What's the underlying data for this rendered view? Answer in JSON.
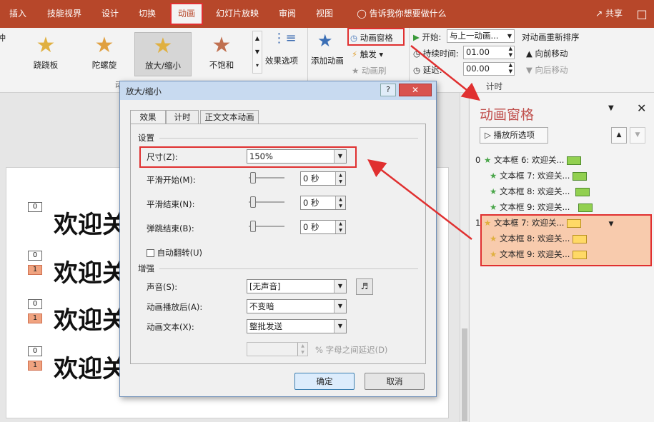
{
  "tabs": [
    "插入",
    "技能视界",
    "设计",
    "切换",
    "动画",
    "幻灯片放映",
    "审阅",
    "视图"
  ],
  "tell_me": "告诉我你想要做什么",
  "share": "共享",
  "gallery": {
    "partial": "冲",
    "items": [
      "跷跷板",
      "陀螺旋",
      "放大/缩小",
      "不饱和"
    ]
  },
  "effect_options": "效果选项",
  "group_animation_partial": "动",
  "add_animation": "添加动画",
  "anim_pane_button": "动画窗格",
  "trigger": "触发",
  "anim_brush": "动画刷",
  "timing": {
    "start_label": "开始:",
    "start_value": "与上一动画...",
    "duration_label": "持续时间:",
    "duration_value": "01.00",
    "delay_label": "延迟:",
    "delay_value": "00.00",
    "group": "计时"
  },
  "reorder": {
    "title": "对动画重新排序",
    "forward": "向前移动",
    "backward": "向后移动"
  },
  "slide": {
    "rows": [
      {
        "badges": [
          "0"
        ],
        "text": "欢迎关"
      },
      {
        "badges": [
          "0",
          "1"
        ],
        "text": "欢迎关"
      },
      {
        "badges": [
          "0",
          "1"
        ],
        "text": "欢迎关"
      },
      {
        "badges": [
          "0",
          "1"
        ],
        "text": "欢迎关"
      }
    ]
  },
  "pane": {
    "title": "动画窗格",
    "play": "播放所选项",
    "items": [
      {
        "num": "0",
        "label": "文本框 6: 欢迎关...",
        "color": "green"
      },
      {
        "num": "",
        "label": "文本框 7: 欢迎关...",
        "color": "green"
      },
      {
        "num": "",
        "label": "文本框 8: 欢迎关...",
        "color": "green"
      },
      {
        "num": "",
        "label": "文本框 9: 欢迎关...",
        "color": "green"
      },
      {
        "num": "1",
        "label": "文本框 7: 欢迎关...",
        "color": "yellow"
      },
      {
        "num": "",
        "label": "文本框 8: 欢迎关...",
        "color": "yellow"
      },
      {
        "num": "",
        "label": "文本框 9: 欢迎关...",
        "color": "yellow"
      }
    ]
  },
  "dialog": {
    "title": "放大/缩小",
    "help": "?",
    "tabs": [
      "效果",
      "计时",
      "正文文本动画"
    ],
    "settings_header": "设置",
    "size_label": "尺寸(Z):",
    "size_value": "150%",
    "smooth_start_label": "平滑开始(M):",
    "smooth_start_value": "0 秒",
    "smooth_end_label": "平滑结束(N):",
    "smooth_end_value": "0 秒",
    "bounce_end_label": "弹跳结束(B):",
    "bounce_end_value": "0 秒",
    "auto_reverse": "自动翻转(U)",
    "enhance_header": "增强",
    "sound_label": "声音(S):",
    "sound_value": "[无声音]",
    "after_label": "动画播放后(A):",
    "after_value": "不变暗",
    "text_label": "动画文本(X):",
    "text_value": "整批发送",
    "delay_suffix": "% 字母之间延迟(D)",
    "ok": "确定",
    "cancel": "取消"
  },
  "colors": {
    "accent": "#b7472a",
    "highlight": "#e03030",
    "green": "#92d050",
    "yellow": "#ffd966"
  }
}
